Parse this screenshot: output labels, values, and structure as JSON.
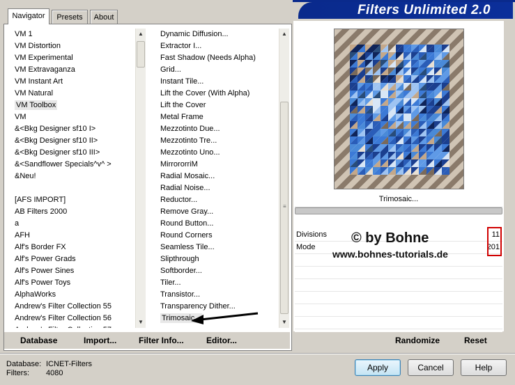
{
  "window": {
    "title": "Filters Unlimited 2.0"
  },
  "tabs": [
    {
      "label": "Navigator",
      "active": true
    },
    {
      "label": "Presets",
      "active": false
    },
    {
      "label": "About",
      "active": false
    }
  ],
  "categories": {
    "items": [
      "VM 1",
      "VM Distortion",
      "VM Experimental",
      "VM Extravaganza",
      "VM Instant Art",
      "VM Natural",
      "VM Toolbox",
      "VM",
      "&<Bkg Designer sf10 I>",
      "&<Bkg Designer sf10 II>",
      "&<Bkg Designer sf10 III>",
      "&<Sandflower Specials^v^ >",
      "&Neu!",
      "",
      "[AFS IMPORT]",
      "AB Filters 2000",
      "a",
      "AFH",
      "Alf's Border FX",
      "Alf's Power Grads",
      "Alf's Power Sines",
      "Alf's Power Toys",
      "AlphaWorks",
      "Andrew's Filter Collection 55",
      "Andrew's Filter Collection 56",
      "Andrew's Filter Collection 57"
    ],
    "selected": "VM Toolbox"
  },
  "filters": {
    "items": [
      "Dynamic Diffusion...",
      "Extractor I...",
      "Fast Shadow (Needs Alpha)",
      "Grid...",
      "Instant Tile...",
      "Lift the Cover (With Alpha)",
      "Lift the Cover",
      "Metal Frame",
      "Mezzotinto Due...",
      "Mezzotinto Tre...",
      "Mezzotinto Uno...",
      "MirrororriM",
      "Radial Mosaic...",
      "Radial Noise...",
      "Reductor...",
      "Remove Gray...",
      "Round Button...",
      "Round Corners",
      "Seamless Tile...",
      "Slipthrough",
      "Softborder...",
      "Tiler...",
      "Transistor...",
      "Transparency Dither...",
      "Trimosaic..."
    ],
    "selected": "Trimosaic..."
  },
  "preview": {
    "filter_name": "Trimosaic..."
  },
  "parameters": [
    {
      "label": "Divisions",
      "value": "11"
    },
    {
      "label": "Mode",
      "value": "201"
    }
  ],
  "watermark": {
    "line1": "© by Bohne",
    "line2": "www.bohnes-tutorials.de"
  },
  "left_buttons": {
    "database": "Database",
    "import": "Import...",
    "filter_info": "Filter Info...",
    "editor": "Editor..."
  },
  "right_buttons": {
    "randomize": "Randomize",
    "reset": "Reset"
  },
  "status": {
    "database_label": "Database:",
    "database_value": "ICNET-Filters",
    "filters_label": "Filters:",
    "filters_value": "4080"
  },
  "dialog_buttons": {
    "apply": "Apply",
    "cancel": "Cancel",
    "help": "Help"
  },
  "colors": {
    "banner": "#0a2a8c",
    "highlight_box": "#d00000"
  }
}
